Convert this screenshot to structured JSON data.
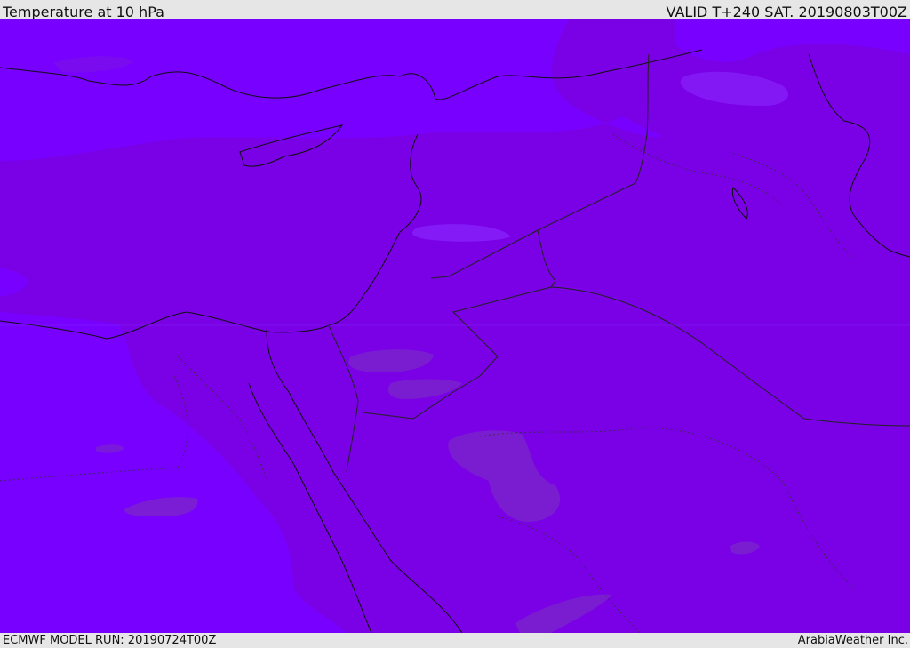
{
  "header": {
    "title": "Temperature at 10 hPa",
    "valid": "VALID T+240 SAT. 20190803T00Z"
  },
  "footer": {
    "model_run": "ECMWF MODEL RUN: 20190724T00Z",
    "credit": "ArabiaWeather Inc."
  },
  "colors": {
    "field_base": "#7a00e6",
    "field_warm_band": "#7800ff",
    "field_cool_patch": "#7a22cc",
    "field_light_patch": "#8a40ff",
    "coastline": "#111111",
    "border": "#222222"
  },
  "map": {
    "variable": "temperature",
    "level": "10 hPa",
    "region": "Middle East"
  }
}
